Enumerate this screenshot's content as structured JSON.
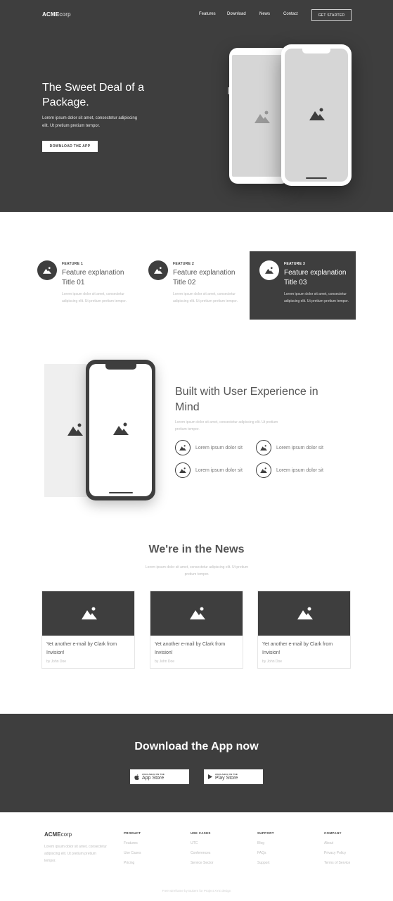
{
  "header": {
    "brand_bold": "ACME",
    "brand_light": "corp",
    "nav": [
      "Features",
      "Download",
      "News",
      "Contact"
    ],
    "cta_label": "GET STARTED"
  },
  "hero": {
    "title": "The Sweet Deal of a Package.",
    "subtitle": "Lorem ipsum dolor sit amet, consectetur adipiscing elit. Ut pretium pretium tempor.",
    "button_label": "DOWNLOAD THE APP"
  },
  "features": [
    {
      "label": "FEATURE 1",
      "title": "Feature explanation Title 01",
      "body": "Lorem ipsum dolor sit amet, consectetur adipiscing elit. Ut pretium pretium tempor."
    },
    {
      "label": "FEATURE 2",
      "title": "Feature explanation Title 02",
      "body": "Lorem ipsum dolor sit amet, consectetur adipiscing elit. Ut pretium pretium tempor."
    },
    {
      "label": "FEATURE 3",
      "title": "Feature explanation Title 03",
      "body": "Lorem ipsum dolor sit amet, consectetur adipiscing elit. Ut pretium pretium tempor."
    }
  ],
  "ux": {
    "title": "Built with User Experience in Mind",
    "subtitle": "Lorem ipsum dolor sit amet, consectetur adipiscing elit. Ut pretium pretium tempor.",
    "items": [
      "Lorem ipsum dolor sit",
      "Lorem ipsum dolor sit",
      "Lorem ipsum dolor sit",
      "Lorem ipsum dolor sit"
    ]
  },
  "news": {
    "title": "We're in the News",
    "subtitle": "Lorem ipsum dolor sit amet, consectetur adipiscing elit. Ut pretium pretium tempor.",
    "cards": [
      {
        "headline": "Yet another e-mail by Clark from Invision!",
        "byline": "by John Doe"
      },
      {
        "headline": "Yet another e-mail by Clark from Invision!",
        "byline": "by John Doe"
      },
      {
        "headline": "Yet another e-mail by Clark from Invision!",
        "byline": "by John Doe"
      }
    ]
  },
  "download": {
    "title": "Download the App now",
    "app_store_small": "AVAILABLE ON THE",
    "app_store_big": "App Store",
    "play_store_small": "AVAILABLE ON THE",
    "play_store_big": "Play Store"
  },
  "footer": {
    "brand_bold": "ACME",
    "brand_light": "corp",
    "about": "Lorem ipsum dolor sit amet, consectetur adipiscing elit. Ut pretium pretium tempor.",
    "columns": [
      {
        "heading": "PRODUCT",
        "links": [
          "Features",
          "Use Cases",
          "Pricing"
        ]
      },
      {
        "heading": "USE CASES",
        "links": [
          "UTC",
          "Conferences",
          "Service Sector"
        ]
      },
      {
        "heading": "SUPPORT",
        "links": [
          "Blog",
          "FAQs",
          "Support"
        ]
      },
      {
        "heading": "COMPANY",
        "links": [
          "About",
          "Privacy Policy",
          "Terms of Service"
        ]
      }
    ],
    "credit": "Free wireframe by Bukem for Project XYZ design"
  },
  "colors": {
    "dark": "#3e3e3e",
    "placeholder": "#d6d6d6",
    "muted_text": "#bdbdbd"
  }
}
